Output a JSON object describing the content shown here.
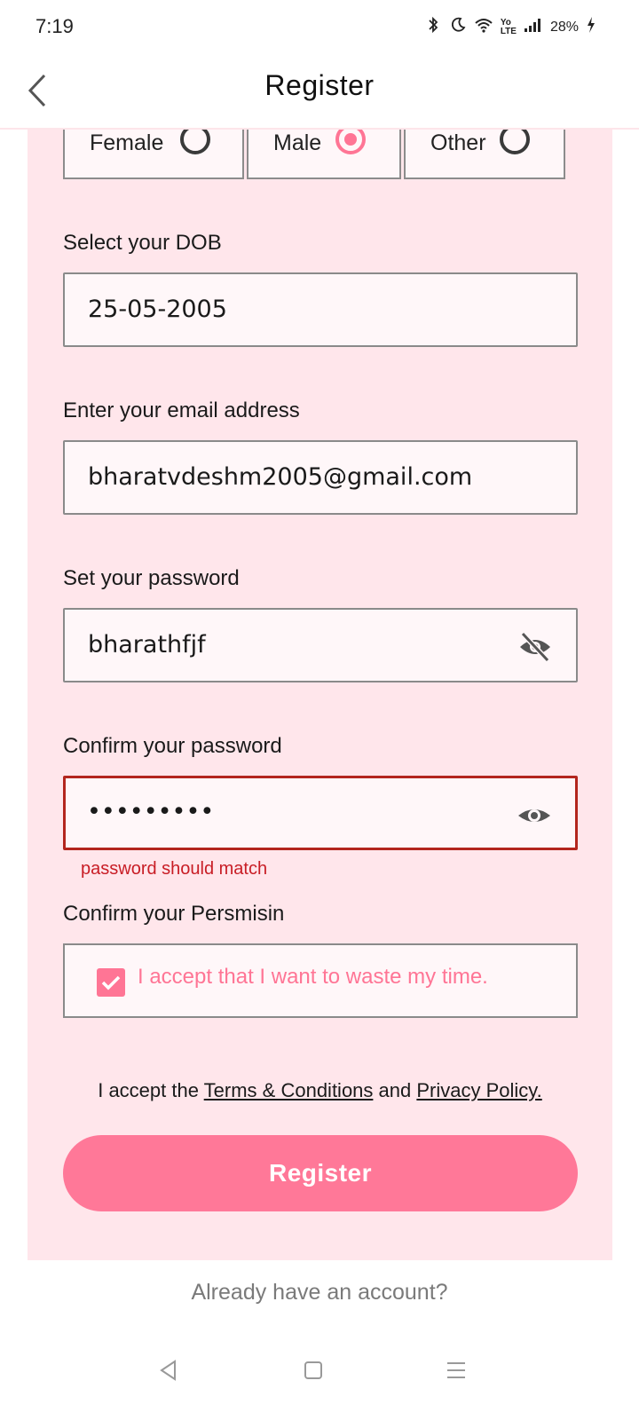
{
  "status_bar": {
    "time": "7:19",
    "battery": "28%",
    "icons": [
      "bluetooth-icon",
      "moon-icon",
      "wifi-icon",
      "volte-icon",
      "signal-icon",
      "battery-charging-icon"
    ]
  },
  "header": {
    "title": "Register",
    "back_icon": "chevron-left-icon"
  },
  "gender": {
    "options": [
      {
        "label": "Female",
        "selected": false
      },
      {
        "label": "Male",
        "selected": true
      },
      {
        "label": "Other",
        "selected": false
      }
    ]
  },
  "dob": {
    "label": "Select your DOB",
    "value": "25-05-2005"
  },
  "email": {
    "label": "Enter your email address",
    "value": "bharatvdeshm2005@gmail.com"
  },
  "password": {
    "label": "Set your password",
    "value": "bharathfjf",
    "toggle_icon": "eye-off-icon"
  },
  "confirm_password": {
    "label": "Confirm your password",
    "value": "•••••••••",
    "toggle_icon": "eye-icon",
    "error": "password should match"
  },
  "permission": {
    "label": "Confirm your Persmisin",
    "checkbox_label": "I accept that I want to waste my time.",
    "checked": true
  },
  "terms": {
    "prefix": "I accept the ",
    "terms_link": "Terms & Conditions",
    "middle": " and ",
    "privacy_link": "Privacy Policy."
  },
  "register_button": "Register",
  "login_link": "Already have an account?",
  "colors": {
    "accent": "#ff7898",
    "card_bg": "#ffe6eb",
    "error": "#b3261e"
  },
  "nav": [
    "back-triangle-icon",
    "home-square-icon",
    "menu-lines-icon"
  ]
}
